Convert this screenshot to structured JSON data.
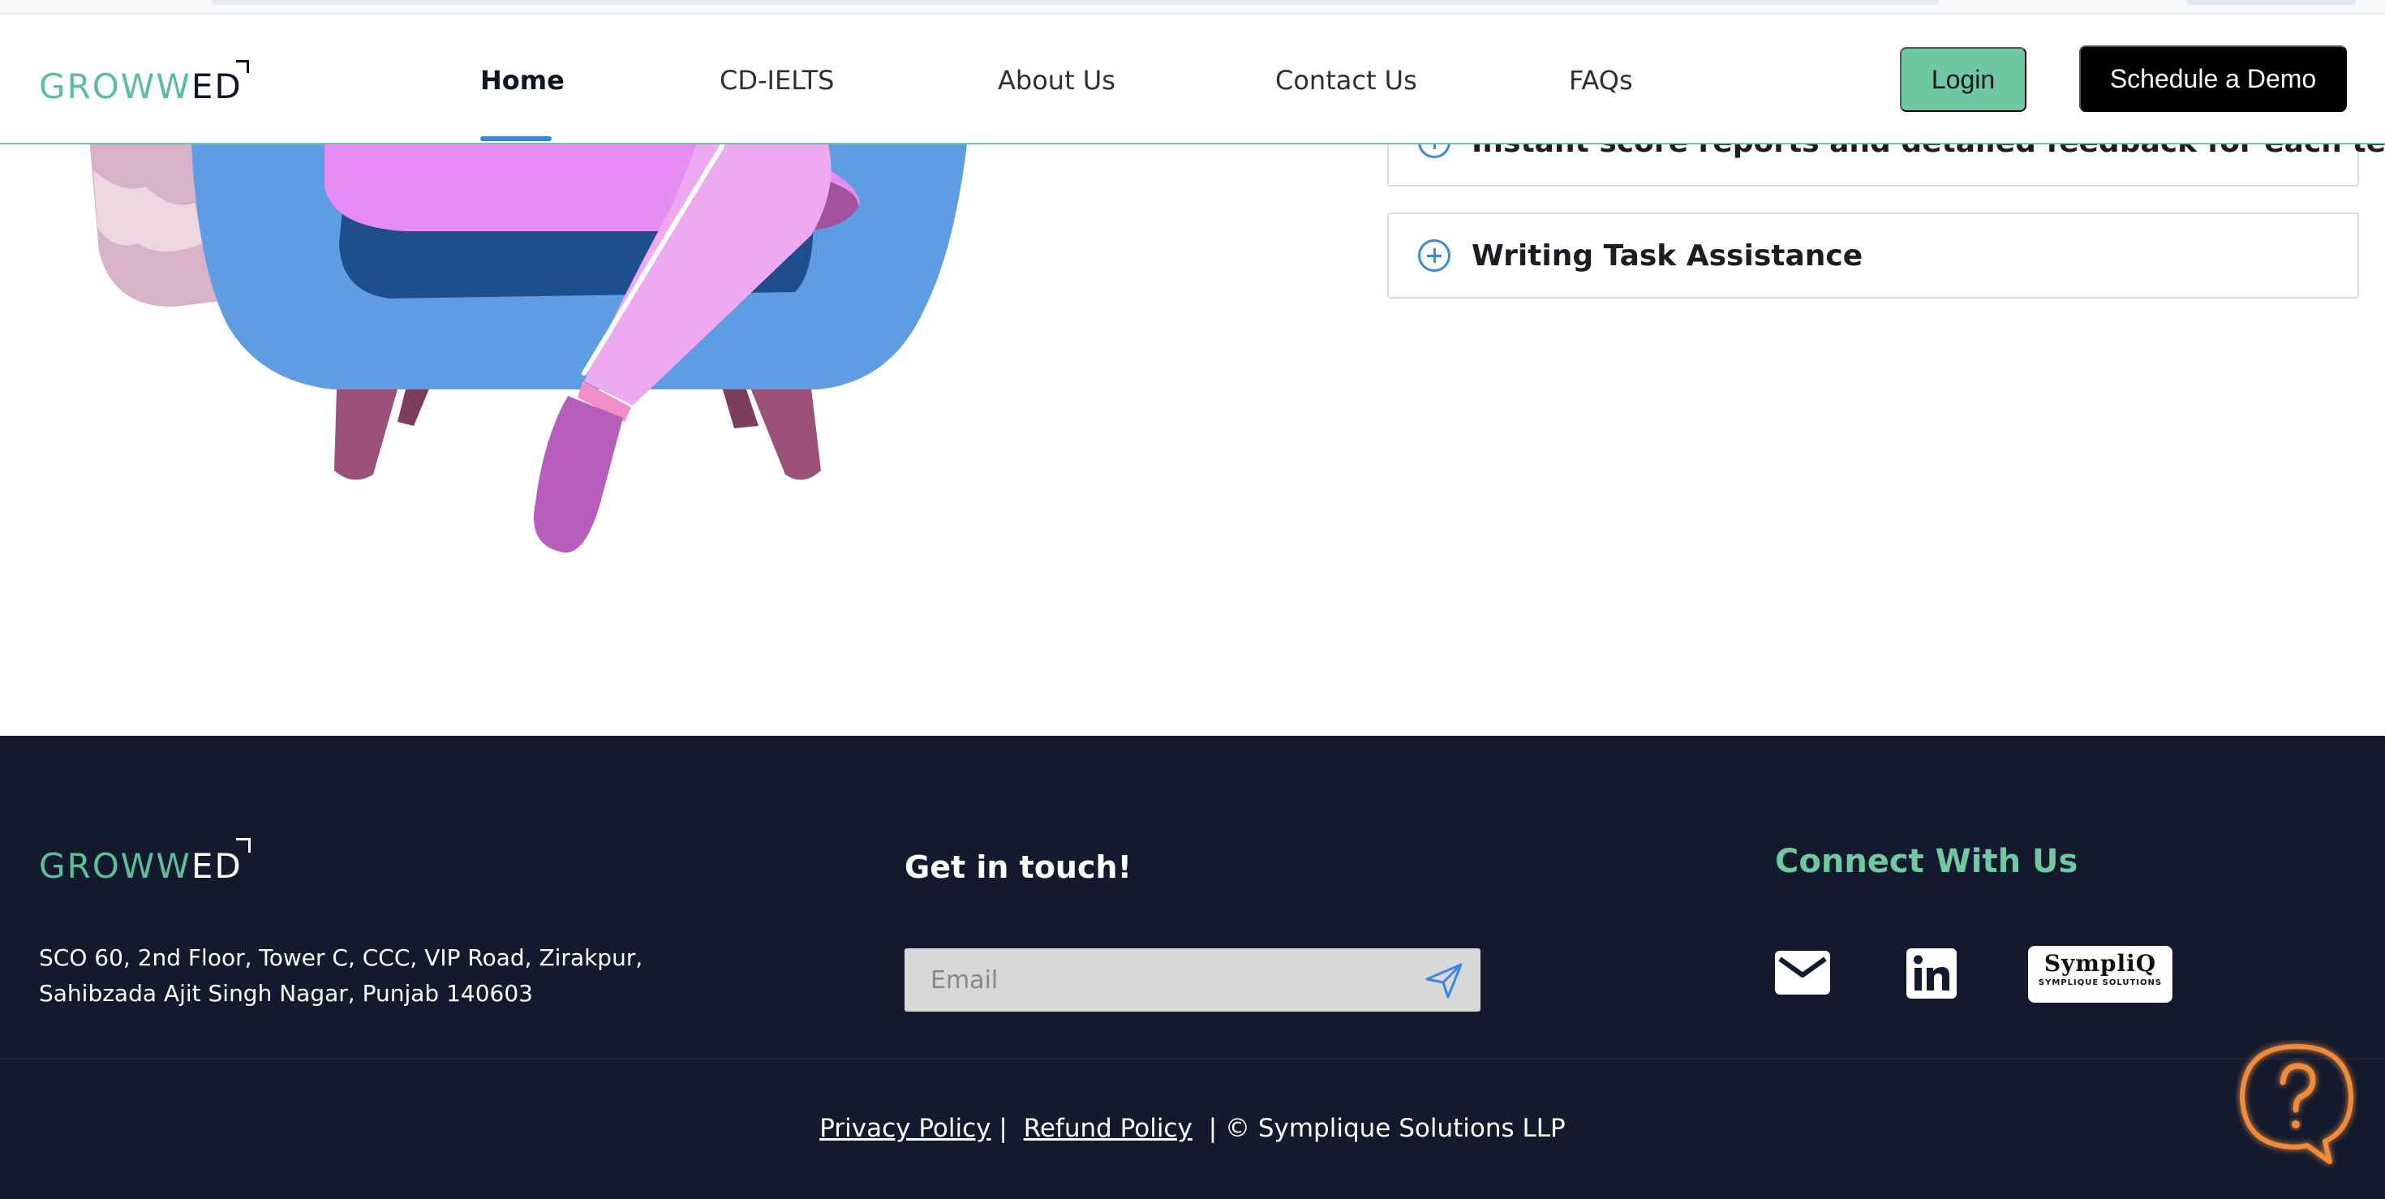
{
  "header": {
    "logo": {
      "part1": "GROWW",
      "part2": "ED"
    },
    "nav": [
      {
        "label": "Home",
        "active": true
      },
      {
        "label": "CD-IELTS",
        "active": false
      },
      {
        "label": "About Us",
        "active": false
      },
      {
        "label": "Contact Us",
        "active": false
      },
      {
        "label": "FAQs",
        "active": false
      }
    ],
    "login_label": "Login",
    "demo_label": "Schedule a Demo"
  },
  "features": {
    "items": [
      {
        "label": "Instant score reports and detailed feedback for each test",
        "icon": "plus-circle-icon"
      },
      {
        "label": "Writing Task Assistance",
        "icon": "plus-circle-icon"
      }
    ]
  },
  "footer": {
    "logo": {
      "part1": "GROWW",
      "part2": "ED"
    },
    "address_line1": "SCO 60, 2nd Floor, Tower C, CCC, VIP Road, Zirakpur,",
    "address_line2": "Sahibzada Ajit Singh Nagar, Punjab 140603",
    "get_in_touch": "Get in touch!",
    "email_placeholder": "Email",
    "connect_title": "Connect With Us",
    "sympliq_brand": "SympliQ",
    "sympliq_sub": "SYMPLIQUE SOLUTIONS",
    "privacy_label": "Privacy Policy",
    "refund_label": "Refund Policy",
    "separator": "|",
    "copyright": "| © Symplique Solutions LLP"
  },
  "colors": {
    "accent_green": "#6fc8a2",
    "active_blue": "#3a86e0",
    "footer_bg": "#131a2d",
    "help_orange": "#f08a3c"
  }
}
